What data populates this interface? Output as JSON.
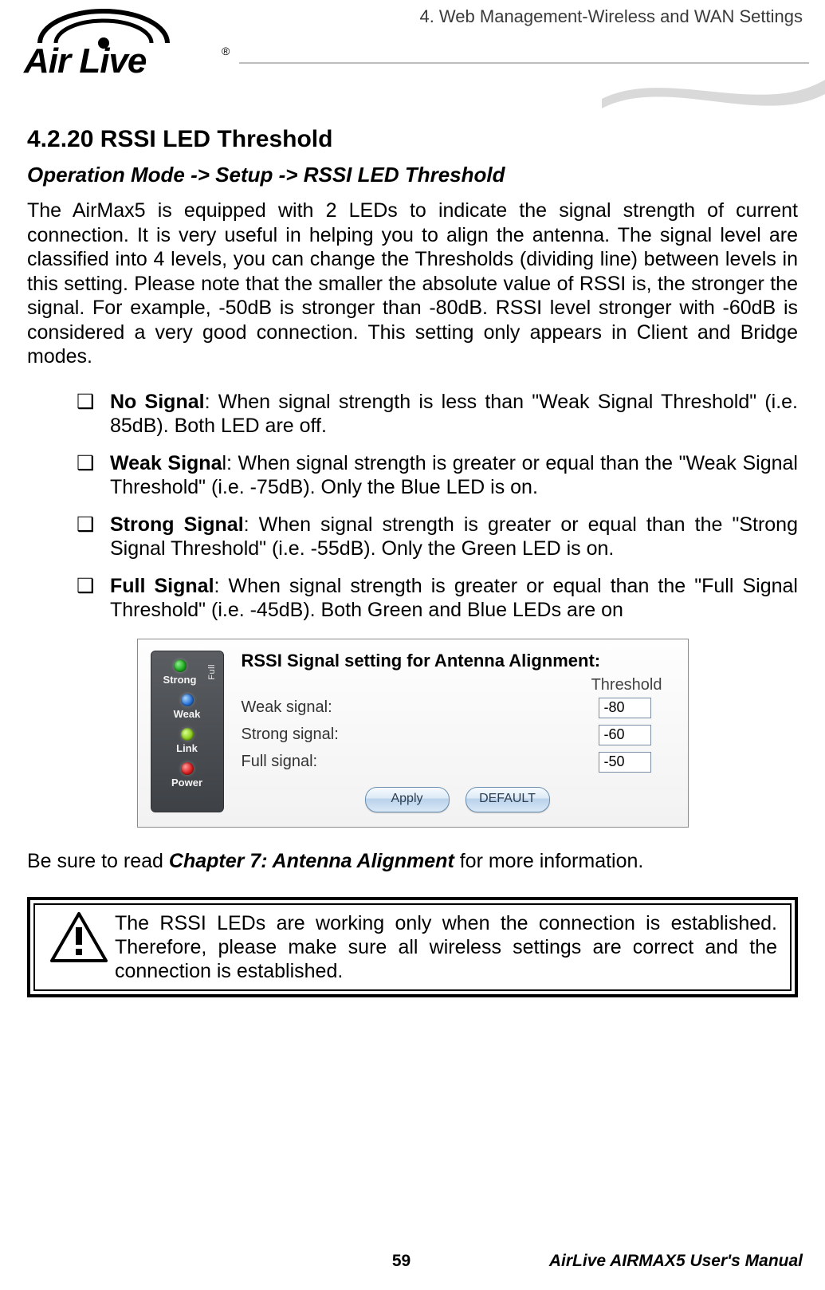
{
  "header": {
    "chapter_title": "4. Web Management-Wireless and WAN Settings",
    "logo_text": "Air Live",
    "logo_reg": "®"
  },
  "section": {
    "number_title": "4.2.20 RSSI LED Threshold",
    "breadcrumb": "Operation Mode -> Setup -> RSSI LED Threshold",
    "intro": "The AirMax5 is equipped with 2 LEDs to indicate the signal strength of current connection. It is very useful in helping you to align the antenna.   The signal level are classified into 4 levels, you can change the Thresholds (dividing line) between levels in this setting. Please note that the smaller the absolute value of RSSI is, the stronger the signal.   For example, -50dB is stronger than -80dB.   RSSI level stronger with -60dB is considered a very good connection.   This setting only appears in Client and Bridge modes."
  },
  "bullets": [
    {
      "term": "No Signal",
      "text": ": When signal strength is less than \"Weak Signal Threshold\" (i.e. 85dB). Both LED are off."
    },
    {
      "term": "Weak Signal",
      "partial_bold": "Weak Signa",
      "rest": "l: When signal strength is greater or equal than the \"Weak Signal Threshold\" (i.e. -75dB).   Only the Blue LED is on."
    },
    {
      "term": "Strong Signal",
      "text": ": When signal strength is greater or equal than the \"Strong Signal Threshold\" (i.e. -55dB).   Only the Green LED is on."
    },
    {
      "term": "Full Signal",
      "text": ": When signal strength is greater or equal than the \"Full Signal Threshold\" (i.e. -45dB).   Both Green and Blue LEDs are on"
    }
  ],
  "screenshot": {
    "title": "RSSI Signal setting for Antenna Alignment:",
    "threshold_header": "Threshold",
    "leds": {
      "full": "Full",
      "strong": "Strong",
      "weak": "Weak",
      "link": "Link",
      "power": "Power"
    },
    "rows": [
      {
        "label": "Weak signal:",
        "value": "-80"
      },
      {
        "label": "Strong signal:",
        "value": "-60"
      },
      {
        "label": "Full signal:",
        "value": "-50"
      }
    ],
    "apply": "Apply",
    "default": "DEFAULT"
  },
  "closing": {
    "pre": "Be sure to read ",
    "ref": "Chapter 7: Antenna Alignment",
    "post": " for more information."
  },
  "warning": {
    "text": "The RSSI LEDs are working only when the connection is established.   Therefore, please make sure all wireless settings are correct and the connection is established."
  },
  "footer": {
    "page": "59",
    "manual": "AirLive AIRMAX5 User's Manual"
  }
}
